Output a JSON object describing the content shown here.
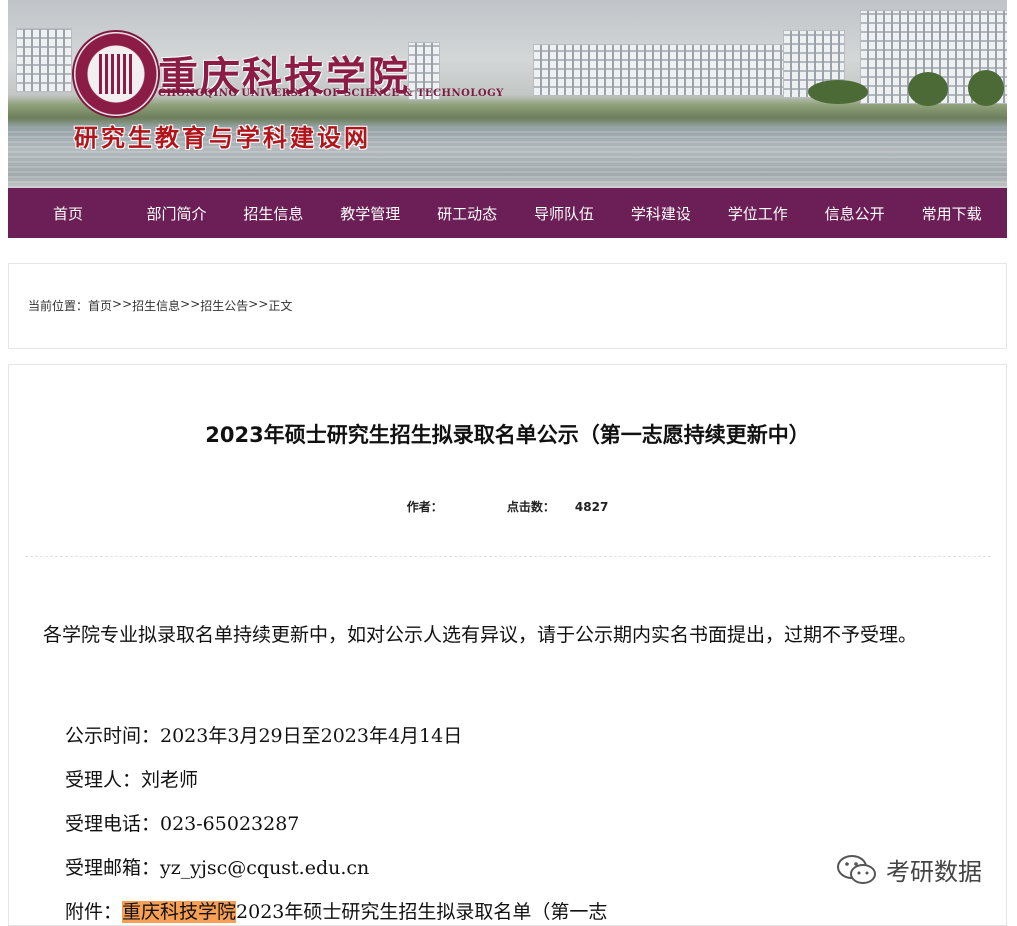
{
  "header": {
    "university_cn": "重庆科技学院",
    "university_en": "CHONGQING UNIVERSITY OF SCIENCE & TECHNOLOGY",
    "site_title": "研究生教育与学科建设网"
  },
  "nav": {
    "items": [
      "首页",
      "部门简介",
      "招生信息",
      "教学管理",
      "研工动态",
      "导师队伍",
      "学科建设",
      "学位工作",
      "信息公开",
      "常用下载"
    ]
  },
  "breadcrumb": {
    "label": "当前位置：",
    "items": [
      "首页",
      "招生信息",
      "招生公告",
      "正文"
    ],
    "separator": ">>"
  },
  "article": {
    "title": "2023年硕士研究生招生拟录取名单公示（第一志愿持续更新中）",
    "author_label": "作者：",
    "author": "",
    "clicks_label": "点击数：",
    "clicks": "4827",
    "paragraph": "各学院专业拟录取名单持续更新中，如对公示人选有异议，请于公示期内实名书面提出，过期不予受理。",
    "notice_time": "公示时间：2023年3月29日至2023年4月14日",
    "contact_person": "受理人：刘老师",
    "contact_phone": "受理电话：023-65023287",
    "contact_email": "受理邮箱：yz_yjsc@cqust.edu.cn",
    "attachment_label": "附件：",
    "attachment_highlight": "重庆科技学院",
    "attachment_text": "2023年硕士研究生招生拟录取名单（第一志"
  },
  "watermark": {
    "icon": "wechat-icon",
    "text": "考研数据"
  }
}
